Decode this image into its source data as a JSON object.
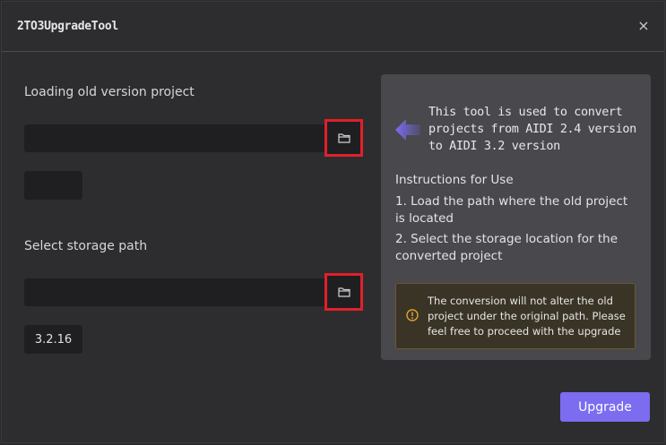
{
  "window": {
    "title": "2TO3UpgradeTool",
    "close_symbol": "×"
  },
  "old_project": {
    "label": "Loading old version project",
    "path_value": "",
    "browse_icon": "folder-icon",
    "version": ""
  },
  "storage": {
    "label": "Select storage path",
    "path_value": "",
    "browse_icon": "folder-icon",
    "version": "3.2.16"
  },
  "info_panel": {
    "icon": "arrow-left-icon",
    "headline": "This tool is used to convert projects from AIDI 2.4 version to AIDI 3.2 version",
    "instructions_title": "Instructions for Use",
    "instructions": [
      "1. Load the path where the old project is located",
      "2. Select the storage location for the converted project"
    ],
    "warning_icon": "warning-icon",
    "warning": "The conversion will not alter the old project under the original path. Please feel free to proceed with the upgrade"
  },
  "actions": {
    "upgrade_label": "Upgrade"
  },
  "colors": {
    "accent": "#7b6cf0",
    "highlight_border": "#e0202a",
    "warning": "#e0a030"
  }
}
